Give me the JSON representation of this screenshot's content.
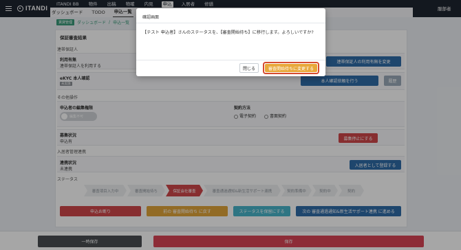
{
  "app": {
    "logo_text": "ITANDI",
    "nav": [
      "ITANDI BB",
      "物件",
      "出稿",
      "物確",
      "内見",
      "申込",
      "入居者",
      "修繕"
    ],
    "nav_active": "申込",
    "user_label": "服部者"
  },
  "subnav": {
    "tabs": [
      "ダッシュボード",
      "TODO",
      "申込一覧"
    ],
    "active": "申込一覧"
  },
  "breadcrumb": {
    "badge": "賃貸管理",
    "items": [
      "ダッシュボード",
      "申込一覧"
    ],
    "separator": "/"
  },
  "screening": {
    "title": "保証審査結果"
  },
  "guarantor": {
    "section_label": "連帯保証人",
    "field_name": "利用有無",
    "field_value": "連帯保証人を利用する",
    "change_button": "連帯保証人の利用有無を変更"
  },
  "ekyc": {
    "field_name": "eKYC 本人確認",
    "badge": "未実施",
    "request_button": "本人確認依頼を行う",
    "history_button": "履歴"
  },
  "other": {
    "section_label": "その他操作",
    "edit_perm_label": "申込者の編集権限",
    "toggle_label": "編集不可",
    "contract_label": "契約方法",
    "contract_options": [
      "電子契約",
      "書面契約"
    ]
  },
  "recruitment": {
    "field_name": "募集状況",
    "field_value": "申込有",
    "stop_button": "募集停止にする"
  },
  "resident": {
    "section_label": "入居者管理連携",
    "field_name": "連携状況",
    "field_value": "未連携",
    "register_button": "入居者として登録する"
  },
  "status": {
    "section_label": "ステータス",
    "steps": [
      "審査項目入力中",
      "審査開始待ち",
      "保証会社審査",
      "審査通過通知&新生活サポート連携",
      "契約準備中",
      "契約中",
      "契約"
    ],
    "active_step": "保証会社審査"
  },
  "actions": {
    "decline": "申込お断り",
    "back": "前の 審査開始待ち に戻す",
    "hold": "ステータスを保留にする",
    "next": "次の 審査通過通知&新生活サポート連携 に進める"
  },
  "footer": {
    "temp_save": "一時保存",
    "save": "保存"
  },
  "modal": {
    "title": "確認画面",
    "message": "【テスト 申込者】さんのステータスを、【審査開始待ち】に移行します。よろしいですか?",
    "close_button": "閉じる",
    "confirm_button": "審査開始待ちに変更する"
  },
  "colors": {
    "topbar": "#1e2530",
    "primary_blue": "#2f6ca8",
    "danger_red": "#d0484a",
    "warning_orange": "#e1a53a",
    "accent_teal": "#47b4c9",
    "confirm_border": "#d64a2e"
  }
}
